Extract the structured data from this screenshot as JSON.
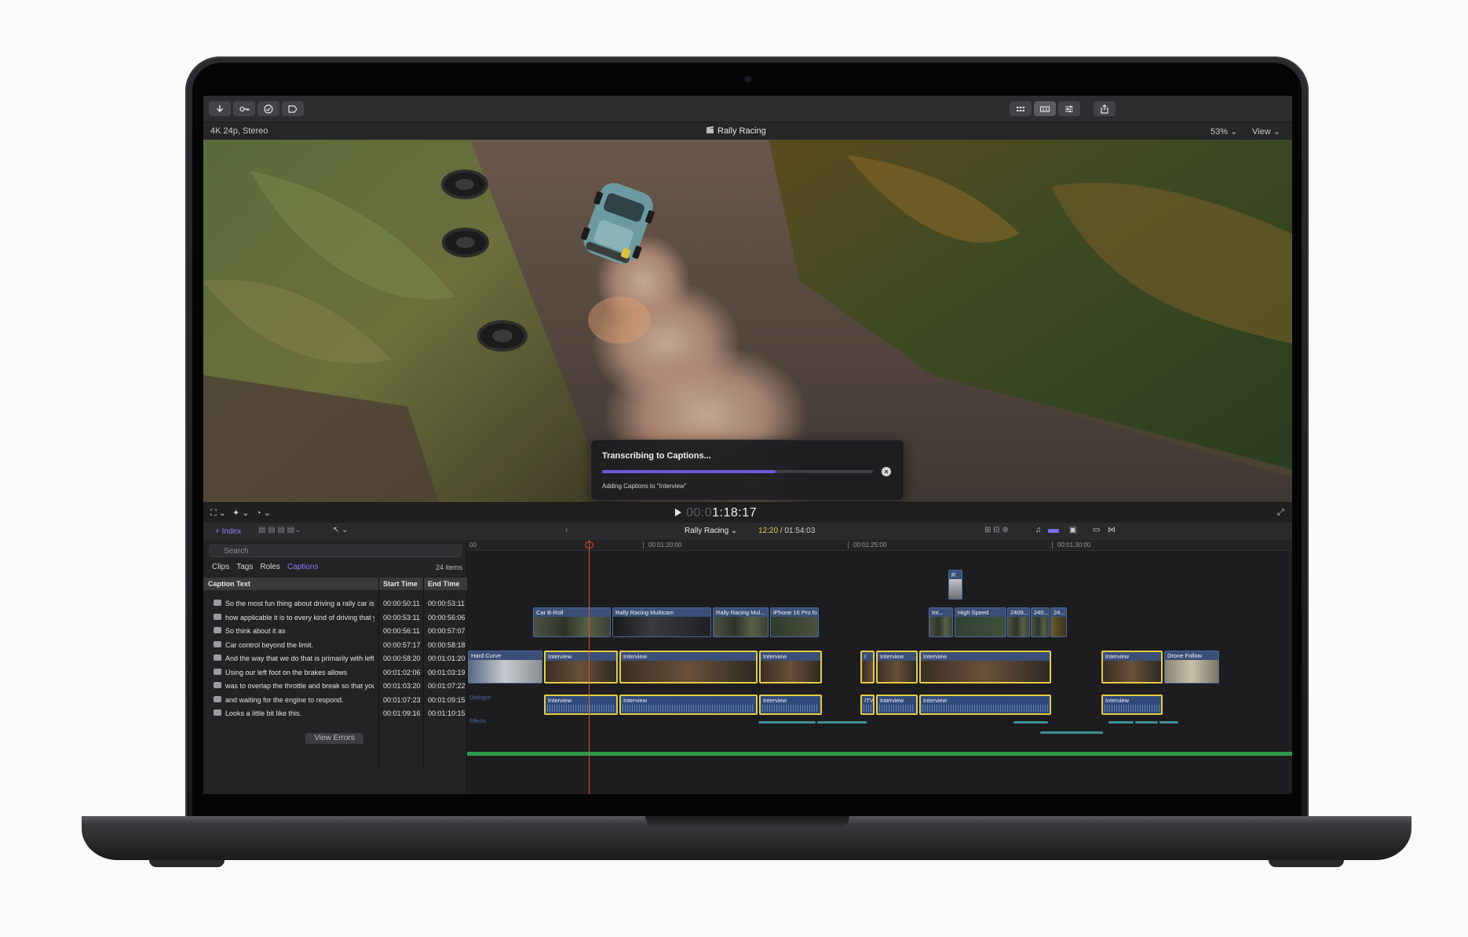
{
  "toolbar": {
    "left_buttons": [
      "import-icon",
      "keywords-icon",
      "checkmark-icon",
      "tag-icon"
    ],
    "right_buttons": [
      "grid-icon",
      "filmstrip-icon",
      "sliders-icon",
      "share-icon"
    ]
  },
  "viewer": {
    "format": "4K 24p, Stereo",
    "title": "Rally Racing",
    "zoom": "53%",
    "view_menu": "View"
  },
  "dialog": {
    "title": "Transcribing to Captions...",
    "subtitle": "Adding Captions to \"Interview\"",
    "progress": 0.64,
    "accent": "#6a5bd8"
  },
  "transport": {
    "timecode_dim": "00:0",
    "timecode": "1:18:17"
  },
  "timeline_header": {
    "index_label": "Index",
    "project": "Rally Racing",
    "position": "12:20",
    "duration": "01:54:03"
  },
  "index": {
    "search_placeholder": "Search",
    "tabs": [
      "Clips",
      "Tags",
      "Roles",
      "Captions"
    ],
    "active_tab": "Captions",
    "count": "24 items",
    "columns": [
      "Caption Text",
      "Start Time",
      "End Time"
    ],
    "rows": [
      {
        "text": "So the most fun thing about driving a rally car is",
        "start": "00:00:50:11",
        "end": "00:00:53:11"
      },
      {
        "text": "how applicable it is to every kind of driving that you...",
        "start": "00:00:53:11",
        "end": "00:00:56:06"
      },
      {
        "text": "So think about it as",
        "start": "00:00:56:11",
        "end": "00:00:57:07"
      },
      {
        "text": "Car control beyond the limit.",
        "start": "00:00:57:17",
        "end": "00:00:58:18"
      },
      {
        "text": "And the way that we do that is primarily with left loo...",
        "start": "00:00:58:20",
        "end": "00:01:01:20"
      },
      {
        "text": "Using our left foot on the brakes allows",
        "start": "00:01:02:06",
        "end": "00:01:03:19"
      },
      {
        "text": "was to overlap the throttle and break so that you re...",
        "start": "00:01:03:20",
        "end": "00:01:07:22"
      },
      {
        "text": "and waiting for the engine to respond.",
        "start": "00:01:07:23",
        "end": "00:01:09:15"
      },
      {
        "text": "Looks a little bit like this.",
        "start": "00:01:09:16",
        "end": "00:01:10:15"
      }
    ],
    "view_errors": "View Errors"
  },
  "ruler": {
    "ticks": [
      "00",
      "00:01:20:00",
      "00:01:25:00",
      "00:01:30:00"
    ]
  },
  "clips": {
    "connected": [
      "Car B-Roll",
      "Rally Racing Multicam",
      "Rally Racing Mul...",
      "iPhone 16 Pro fo...",
      "Int...",
      "High Speed",
      "2409...",
      "240...",
      "24...",
      "R"
    ],
    "primary": [
      "Hard Curve",
      "Interview",
      "Interview",
      "Interview",
      "I",
      "Interview",
      "Interview",
      "Interview",
      "Drone Follow"
    ],
    "audio": [
      "Interview",
      "Interview",
      "Interview",
      "ITV",
      "Interview",
      "Interview",
      "Interview"
    ],
    "lanes": [
      "Dialogue",
      "Effects"
    ]
  }
}
